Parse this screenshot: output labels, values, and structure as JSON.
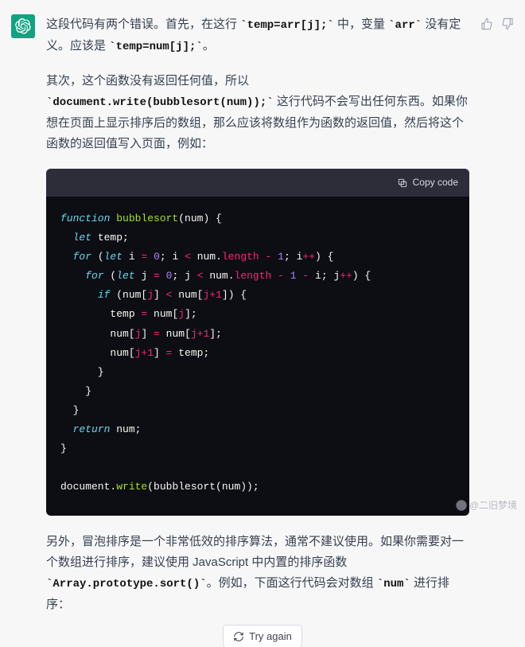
{
  "response": {
    "para1": {
      "t1": "这段代码有两个错误。首先，在这行 ",
      "c1": "`temp=arr[j];`",
      "t2": " 中，变量 ",
      "c2": "`arr`",
      "t3": " 没有定义。应该是 ",
      "c3": "`temp=num[j];`",
      "t4": "。"
    },
    "para2": {
      "t1": "其次，这个函数没有返回任何值，所以 ",
      "c1": "`document.write(bubblesort(num));`",
      "t2": " 这行代码不会写出任何东西。如果你想在页面上显示排序后的数组，那么应该将数组作为函数的返回值，然后将这个函数的返回值写入页面，例如："
    },
    "copy_label": "Copy code",
    "code": {
      "l1_kw": "function",
      "l1_fn": " bubblesort",
      "l1_rest": "(num) {",
      "l2a": "  ",
      "l2_kw": "let",
      "l2b": " temp;",
      "l3a": "  ",
      "l3_kw": "for",
      "l3b": " (",
      "l3_kw2": "let",
      "l3c": " i ",
      "l3_op": "=",
      "l3d": " ",
      "l3_num": "0",
      "l3e": "; i ",
      "l3_op2": "<",
      "l3f": " num.",
      "l3_prop": "length",
      "l3g": " ",
      "l3_op3": "-",
      "l3h": " ",
      "l3_num2": "1",
      "l3i": "; i",
      "l3_op4": "++",
      "l3j": ") {",
      "l4a": "    ",
      "l4_kw": "for",
      "l4b": " (",
      "l4_kw2": "let",
      "l4c": " j ",
      "l4_op": "=",
      "l4d": " ",
      "l4_num": "0",
      "l4e": "; j ",
      "l4_op2": "<",
      "l4f": " num.",
      "l4_prop": "length",
      "l4g": " ",
      "l4_op3": "-",
      "l4h": " ",
      "l4_num2": "1",
      "l4i": " ",
      "l4_op4": "-",
      "l4j": " i; j",
      "l4_op5": "++",
      "l4k": ") {",
      "l5a": "      ",
      "l5_kw": "if",
      "l5b": " (num[",
      "l5_prop": "j",
      "l5c": "] ",
      "l5_op": "<",
      "l5d": " num[",
      "l5_prop2": "j+1",
      "l5e": "]) {",
      "l6a": "        temp ",
      "l6_op": "=",
      "l6b": " num[",
      "l6_prop": "j",
      "l6c": "];",
      "l7a": "        num[",
      "l7_prop": "j",
      "l7b": "] ",
      "l7_op": "=",
      "l7c": " num[",
      "l7_prop2": "j+1",
      "l7d": "];",
      "l8a": "        num[",
      "l8_prop": "j+1",
      "l8b": "] ",
      "l8_op": "=",
      "l8c": " temp;",
      "l9": "      }",
      "l10": "    }",
      "l11": "  }",
      "l12a": "  ",
      "l12_kw": "return",
      "l12b": " num;",
      "l13": "}",
      "l14": "",
      "l15a": "document.",
      "l15_fn": "write",
      "l15b": "(bubblesort(num));"
    },
    "para3": {
      "t1": "另外，冒泡排序是一个非常低效的排序算法，通常不建议使用。如果你需要对一个数组进行排序，建议使用 JavaScript 中内置的排序函数 ",
      "c1": "`Array.prototype.sort()`",
      "t2": "。例如，下面这行代码会对数组 ",
      "c2": "`num`",
      "t3": " 进行排序："
    }
  },
  "try_again_label": "Try again",
  "watermark_text": "@二旧梦境"
}
